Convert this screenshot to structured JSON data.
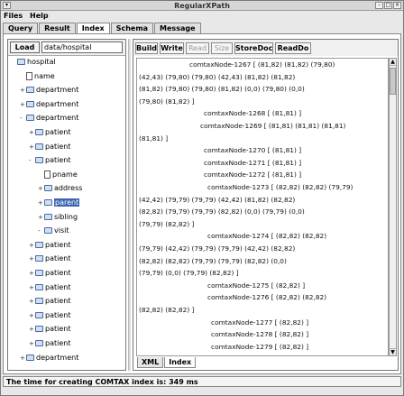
{
  "window": {
    "title": "RegularXPath",
    "system_icon": "window-menu-icon",
    "controls": [
      "minimize-icon",
      "maximize-icon",
      "close-icon"
    ]
  },
  "menubar": {
    "items": [
      "Files",
      "Help"
    ]
  },
  "main_tabs": [
    "Query",
    "Result",
    "Index",
    "Schema",
    "Message"
  ],
  "main_tabs_active": "Index",
  "left_panel": {
    "load_label": "Load",
    "path_value": "data/hospital",
    "tree": [
      {
        "label": "hospital",
        "icon": "folder",
        "depth": 0,
        "toggle": ""
      },
      {
        "label": "name",
        "icon": "doc",
        "depth": 1,
        "toggle": ""
      },
      {
        "label": "department",
        "icon": "folder",
        "depth": 1,
        "toggle": "+"
      },
      {
        "label": "department",
        "icon": "folder",
        "depth": 1,
        "toggle": "+"
      },
      {
        "label": "department",
        "icon": "folder",
        "depth": 1,
        "toggle": "-"
      },
      {
        "label": "patient",
        "icon": "folder",
        "depth": 2,
        "toggle": "+"
      },
      {
        "label": "patient",
        "icon": "folder",
        "depth": 2,
        "toggle": "+"
      },
      {
        "label": "patient",
        "icon": "folder",
        "depth": 2,
        "toggle": "-"
      },
      {
        "label": "pname",
        "icon": "doc",
        "depth": 3,
        "toggle": ""
      },
      {
        "label": "address",
        "icon": "folder",
        "depth": 3,
        "toggle": "+"
      },
      {
        "label": "parent",
        "icon": "folder",
        "depth": 3,
        "toggle": "+",
        "selected": true
      },
      {
        "label": "sibling",
        "icon": "folder",
        "depth": 3,
        "toggle": "+"
      },
      {
        "label": "visit",
        "icon": "folder",
        "depth": 3,
        "toggle": "-"
      },
      {
        "label": "patient",
        "icon": "folder",
        "depth": 2,
        "toggle": "+"
      },
      {
        "label": "patient",
        "icon": "folder",
        "depth": 2,
        "toggle": "+"
      },
      {
        "label": "patient",
        "icon": "folder",
        "depth": 2,
        "toggle": "+"
      },
      {
        "label": "patient",
        "icon": "folder",
        "depth": 2,
        "toggle": "+"
      },
      {
        "label": "patient",
        "icon": "folder",
        "depth": 2,
        "toggle": "+"
      },
      {
        "label": "patient",
        "icon": "folder",
        "depth": 2,
        "toggle": "+"
      },
      {
        "label": "patient",
        "icon": "folder",
        "depth": 2,
        "toggle": "+"
      },
      {
        "label": "patient",
        "icon": "folder",
        "depth": 2,
        "toggle": "+"
      },
      {
        "label": "department",
        "icon": "folder",
        "depth": 1,
        "toggle": "+"
      }
    ]
  },
  "right_panel": {
    "toolbar": [
      {
        "label": "Build",
        "enabled": true
      },
      {
        "label": "Write",
        "enabled": true
      },
      {
        "label": "Read",
        "enabled": false
      },
      {
        "label": "Size",
        "enabled": false
      },
      {
        "label": "StoreDoc",
        "enabled": true
      },
      {
        "label": "ReadDo",
        "enabled": true
      }
    ],
    "lines": [
      "comtaxNode-1267 [ (81,82) (81,82) (79,80)",
      "(42,43) (79,80) (79,80) (42,43) (81,82) (81,82)",
      "(81,82) (79,80) (79,80) (81,82) (0,0) (79,80) (0,0)",
      "(79,80) (81,82) ]",
      "comtaxNode-1268 [ (81,81) ]",
      "comtaxNode-1269 [ (81,81) (81,81) (81,81)",
      "(81,81) ]",
      "comtaxNode-1270 [ (81,81) ]",
      "comtaxNode-1271 [ (81,81) ]",
      "comtaxNode-1272 [ (81,81) ]",
      "comtaxNode-1273 [ (82,82) (82,82) (79,79)",
      "(42,42) (79,79) (79,79) (42,42) (81,82) (82,82)",
      "(82,82) (79,79) (79,79) (82,82) (0,0) (79,79) (0,0)",
      "(79,79) (82,82) ]",
      "comtaxNode-1274 [ (82,82) (82,82)",
      "(79,79) (42,42) (79,79) (79,79) (42,42) (82,82)",
      "(82,82) (82,82) (79,79) (79,79) (82,82) (0,0)",
      "(79,79) (0,0) (79,79) (82,82) ]",
      "comtaxNode-1275 [ (82,82) ]",
      "comtaxNode-1276 [ (82,82) (82,82)",
      "(82,82) (82,82) ]",
      "comtaxNode-1277 [ (82,82) ]",
      "comtaxNode-1278 [ (82,82) ]",
      "comtaxNode-1279 [ (82,82) ]"
    ],
    "bottom_tabs": [
      "XML",
      "Index"
    ],
    "bottom_tabs_active": "Index"
  },
  "status": "The time for creating COMTAX index is: 349 ms"
}
